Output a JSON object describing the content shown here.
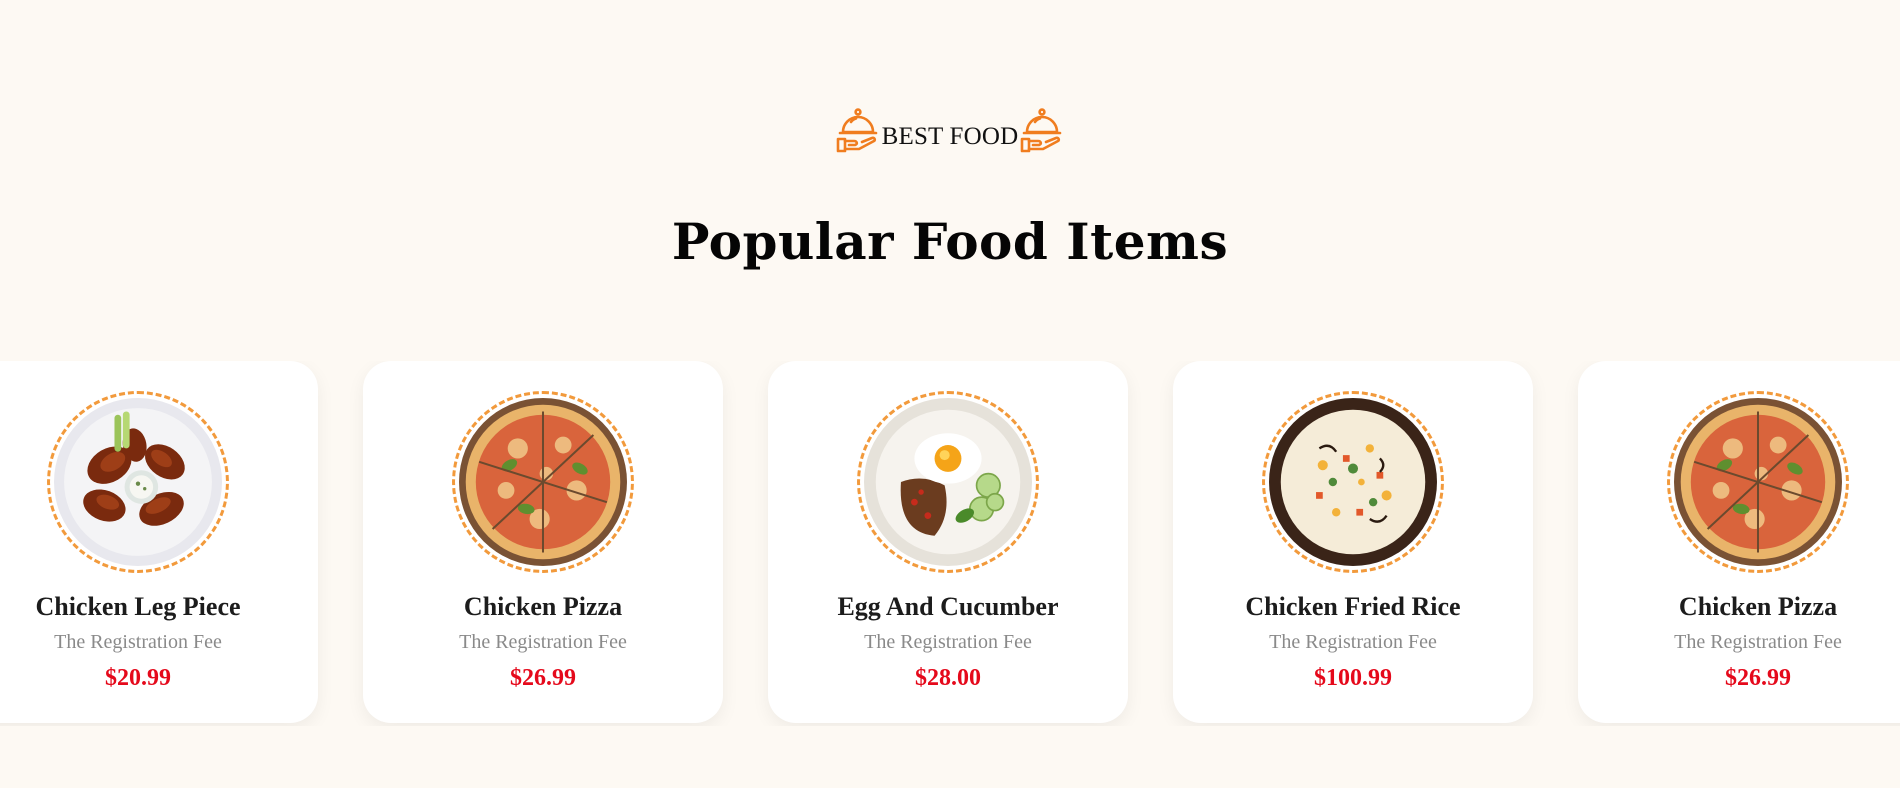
{
  "section": {
    "eyebrow": "BEST FOOD",
    "title": "Popular Food Items",
    "icon": "serving-cloche-icon",
    "accent_color": "#f07d1f",
    "price_color": "#e5091b"
  },
  "items": [
    {
      "name": "Chicken Leg Piece",
      "subtitle": "The Registration Fee",
      "price": "$20.99",
      "image": "chicken-leg-plate"
    },
    {
      "name": "Chicken Pizza",
      "subtitle": "The Registration Fee",
      "price": "$26.99",
      "image": "chicken-pizza"
    },
    {
      "name": "Egg And Cucumber",
      "subtitle": "The Registration Fee",
      "price": "$28.00",
      "image": "egg-cucumber-plate"
    },
    {
      "name": "Chicken Fried Rice",
      "subtitle": "The Registration Fee",
      "price": "$100.99",
      "image": "fried-rice-bowl"
    },
    {
      "name": "Chicken Pizza",
      "subtitle": "The Registration Fee",
      "price": "$26.99",
      "image": "chicken-pizza"
    }
  ]
}
